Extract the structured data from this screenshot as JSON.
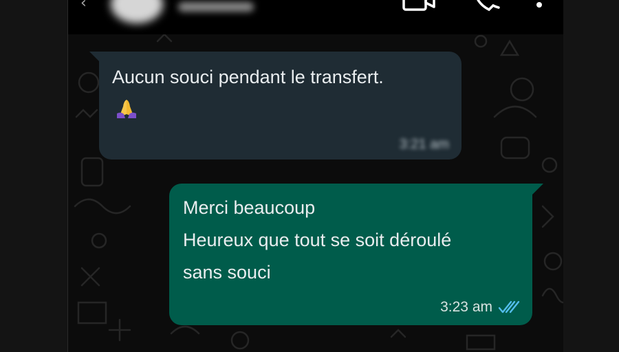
{
  "header": {
    "contact_name": "",
    "icons": [
      "back-arrow-icon",
      "avatar",
      "video-call-icon",
      "voice-call-icon",
      "more-options-icon"
    ]
  },
  "messages": [
    {
      "direction": "incoming",
      "lines": [
        "Aucun souci pendant le transfert."
      ],
      "emoji_icon": "folded-hands-emoji",
      "time": "3:21 am",
      "time_blurred": true
    },
    {
      "direction": "outgoing",
      "lines": [
        "Merci beaucoup",
        "Heureux que tout se soit déroulé",
        "sans souci"
      ],
      "time": "3:23 am",
      "status_icon": "double-check-read-icon"
    }
  ],
  "colors": {
    "incoming_bubble": "#1f2c34",
    "outgoing_bubble": "#005c4b",
    "read_ticks": "#53bdeb",
    "header": "#000000"
  }
}
